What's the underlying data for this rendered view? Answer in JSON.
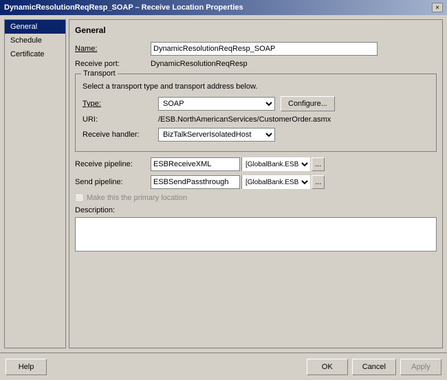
{
  "titlebar": {
    "text": "DynamicResolutionReqResp_SOAP – Receive Location Properties",
    "close_label": "×"
  },
  "sidebar": {
    "items": [
      {
        "label": "General",
        "active": true
      },
      {
        "label": "Schedule",
        "active": false
      },
      {
        "label": "Certificate",
        "active": false
      }
    ]
  },
  "panel": {
    "title": "General",
    "name_label": "Name:",
    "name_value": "DynamicResolutionReqResp_SOAP",
    "receive_port_label": "Receive port:",
    "receive_port_value": "DynamicResolutionReqResp",
    "transport": {
      "legend": "Transport",
      "hint": "Select a transport type and transport address below.",
      "type_label": "Type:",
      "type_value": "SOAP",
      "configure_label": "Configure...",
      "uri_label": "URI:",
      "uri_value": "/ESB.NorthAmericanServices/CustomerOrder.asmx",
      "handler_label": "Receive handler:",
      "handler_value": "BizTalkServerIsolatedHost"
    },
    "receive_pipeline_label": "Receive pipeline:",
    "receive_pipeline_name": "ESBReceiveXML",
    "receive_pipeline_assembly": "[GlobalBank.ESB.Dynamic",
    "send_pipeline_label": "Send pipeline:",
    "send_pipeline_name": "ESBSendPassthrough",
    "send_pipeline_assembly": "[GlobalBank.ESB.Dyr",
    "primary_location_label": "Make this the primary location",
    "description_label": "Description:"
  },
  "buttons": {
    "help": "Help",
    "ok": "OK",
    "cancel": "Cancel",
    "apply": "Apply"
  }
}
